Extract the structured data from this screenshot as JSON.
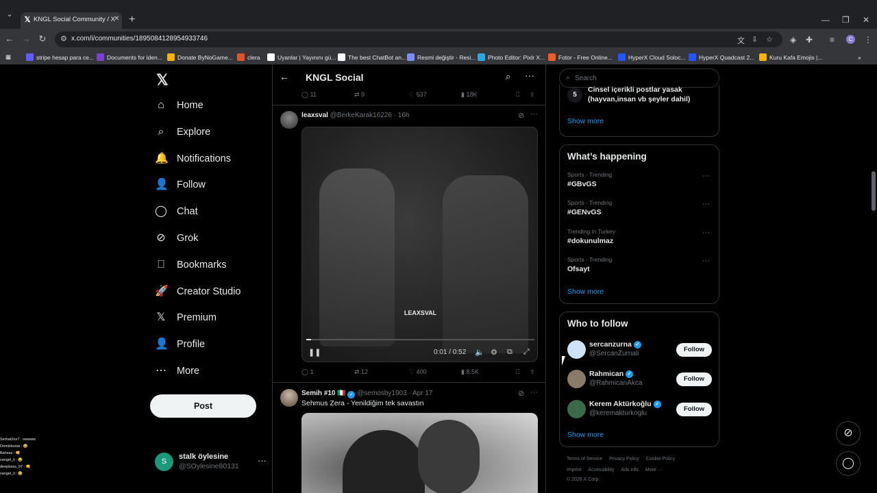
{
  "browser": {
    "tab_title": "KNGL Social Community / X",
    "url": "x.com/i/communities/1895084128954933746",
    "bookmarks": [
      {
        "label": "stripe hesap para ce...",
        "color": "#635bff"
      },
      {
        "label": "Documents for iden...",
        "color": "#7b3fd1"
      },
      {
        "label": "Donate ByNoGame...",
        "color": "#f4b400"
      },
      {
        "label": "clera",
        "color": "#e0542b"
      },
      {
        "label": "Uyanlar | Yayınını gü...",
        "color": "#ffffff"
      },
      {
        "label": "The best ChatBot an...",
        "color": "#ffffff"
      },
      {
        "label": "Resmi değiştir - Resi...",
        "color": "#7c8cff"
      },
      {
        "label": "Photo Editor: Pixlr X...",
        "color": "#2ea7e0"
      },
      {
        "label": "Fotor - Free Online...",
        "color": "#f15b2a"
      },
      {
        "label": "HyperX Cloud Soloc...",
        "color": "#2255ff"
      },
      {
        "label": "HyperX Quadcast 2...",
        "color": "#2255ff"
      },
      {
        "label": "Kuru Kafa Emojis |...",
        "color": "#f4b400"
      }
    ]
  },
  "nav": {
    "items": [
      {
        "label": "Home",
        "icon": "home-icon",
        "glyph": "⌂"
      },
      {
        "label": "Explore",
        "icon": "search-icon",
        "glyph": "⌕"
      },
      {
        "label": "Notifications",
        "icon": "bell-icon",
        "glyph": "🔔"
      },
      {
        "label": "Follow",
        "icon": "person-plus-icon",
        "glyph": "👤"
      },
      {
        "label": "Chat",
        "icon": "chat-icon",
        "glyph": "◯"
      },
      {
        "label": "Grok",
        "icon": "grok-icon",
        "glyph": "⊘"
      },
      {
        "label": "Bookmarks",
        "icon": "bookmark-icon",
        "glyph": "⎕"
      },
      {
        "label": "Creator Studio",
        "icon": "rocket-icon",
        "glyph": "🚀"
      },
      {
        "label": "Premium",
        "icon": "x-logo-icon",
        "glyph": "𝕏"
      },
      {
        "label": "Profile",
        "icon": "person-icon",
        "glyph": "👤"
      },
      {
        "label": "More",
        "icon": "more-circle-icon",
        "glyph": "⋯"
      }
    ],
    "post_label": "Post",
    "account_name": "stalk öylesine",
    "account_handle": "@SOylesine80131",
    "account_initial": "S"
  },
  "overlay_chat": [
    "SerhatXxx7 : owwww",
    "Domkiburak : 😂",
    "Bahsaz : 👊",
    "xangel_li : 😂",
    "deepbass_97 : 👊",
    "xangel_li : 😂"
  ],
  "main": {
    "title": "KNGL Social",
    "top_actions": {
      "replies": "11",
      "reposts": "9",
      "likes": "537",
      "views": "18K"
    },
    "tweet1": {
      "name": "leaxsval",
      "handle": "@BerkeKarak16226 · 16h",
      "watermark": "LEAXSVAL",
      "video_time": "0:01 / 0:52",
      "video_progress": 0.02,
      "actions": {
        "replies": "1",
        "reposts": "12",
        "likes": "400",
        "views": "8.5K"
      }
    },
    "tweet2": {
      "name": "Semih #10 🇮🇹",
      "handle": "@semosby1903 · Apr 17",
      "text": "Sehmus Zera - Yenildiğim tek savastın"
    }
  },
  "right": {
    "search_placeholder": "Search",
    "rule": {
      "number": "5",
      "text_line1": "Cinsel içerikli postlar yasak",
      "text_line2": "(hayvan,insan vb şeyler dahil)"
    },
    "show_more": "Show more",
    "happening_title": "What’s happening",
    "trends": [
      {
        "meta": "Sports · Trending",
        "name": "#GBvGS"
      },
      {
        "meta": "Sports · Trending",
        "name": "#GENvGS"
      },
      {
        "meta": "Trending in Turkey",
        "name": "#dokunulmaz"
      },
      {
        "meta": "Sports · Trending",
        "name": "Ofsayt"
      }
    ],
    "who_title": "Who to follow",
    "follow_label": "Follow",
    "who": [
      {
        "name": "sercanzurna",
        "handle": "@SercanZurnali",
        "avatar_color": "#cfe3f7"
      },
      {
        "name": "Rahmican",
        "handle": "@RahmicanAkca",
        "avatar_color": "#8a7a6a"
      },
      {
        "name": "Kerem Aktürkoğlu",
        "handle": "@keremakturkoglu",
        "avatar_color": "#3a6a4a"
      }
    ],
    "footer_line1": [
      "Terms of Service",
      "Privacy Policy",
      "Cookie Policy"
    ],
    "footer_line2": [
      "Imprint",
      "Accessibility",
      "Ads info",
      "More ···"
    ],
    "copyright": "© 2026 X Corp."
  }
}
